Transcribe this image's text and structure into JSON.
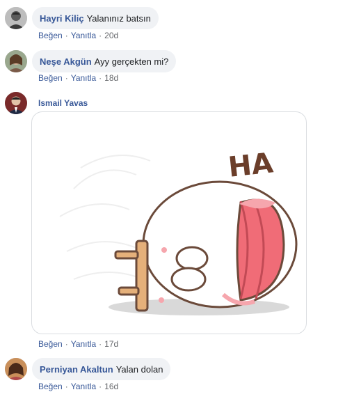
{
  "comments": [
    {
      "author": "Hayri Kiliç",
      "text": "Yalanınız batsın",
      "like": "Beğen",
      "reply": "Yanıtla",
      "time": "20d",
      "avatar_icon": "avatar-icon"
    },
    {
      "author": "Neşe Akgün",
      "text": "Ayy gerçekten mi?",
      "like": "Beğen",
      "reply": "Yanıtla",
      "time": "18d",
      "avatar_icon": "avatar-icon"
    },
    {
      "author": "Ismail Yavas",
      "sticker_text": "HA",
      "like": "Beğen",
      "reply": "Yanıtla",
      "time": "17d",
      "avatar_icon": "avatar-icon"
    },
    {
      "author": "Perniyan Akaltun",
      "text": "Yalan dolan",
      "like": "Beğen",
      "reply": "Yanıtla",
      "time": "16d",
      "avatar_icon": "avatar-icon"
    }
  ],
  "separator": "·",
  "colors": {
    "link": "#385898",
    "meta": "#65676b",
    "bubble": "#f0f2f5",
    "border": "#dadde1"
  }
}
